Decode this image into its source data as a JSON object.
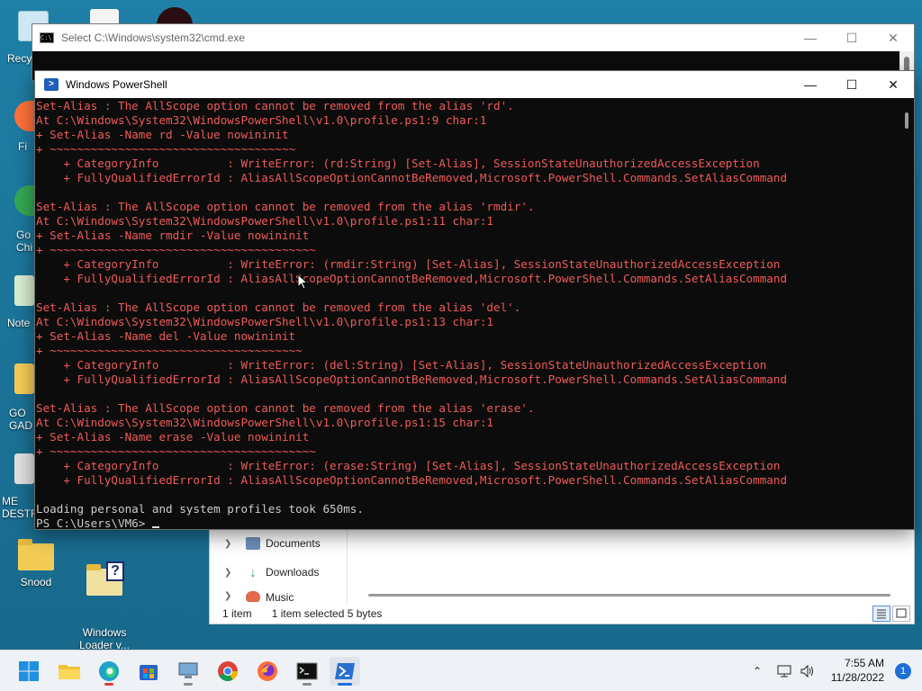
{
  "desktop": {
    "icons": [
      {
        "label": "Snood",
        "icon": "folder-icon"
      },
      {
        "label": "Windows\nLoader v...",
        "icon": "folder-help-icon"
      }
    ],
    "partial_labels": [
      "Recy",
      "Fi",
      "Go\nChi",
      "Note",
      "GO\nGAD",
      "ME\nDESTRU"
    ]
  },
  "cmd_window": {
    "title": "Select C:\\Windows\\system32\\cmd.exe"
  },
  "ps_window": {
    "title": "Windows PowerShell",
    "lines": [
      {
        "type": "error",
        "text": "Set-Alias : The AllScope option cannot be removed from the alias 'rd'."
      },
      {
        "type": "error",
        "text": "At C:\\Windows\\System32\\WindowsPowerShell\\v1.0\\profile.ps1:9 char:1"
      },
      {
        "type": "error",
        "text": "+ Set-Alias -Name rd -Value nowininit"
      },
      {
        "type": "error",
        "text": "+ ~~~~~~~~~~~~~~~~~~~~~~~~~~~~~~~~~~~~"
      },
      {
        "type": "error",
        "text": "    + CategoryInfo          : WriteError: (rd:String) [Set-Alias], SessionStateUnauthorizedAccessException"
      },
      {
        "type": "error",
        "text": "    + FullyQualifiedErrorId : AliasAllScopeOptionCannotBeRemoved,Microsoft.PowerShell.Commands.SetAliasCommand"
      },
      {
        "type": "normal",
        "text": ""
      },
      {
        "type": "error",
        "text": "Set-Alias : The AllScope option cannot be removed from the alias 'rmdir'."
      },
      {
        "type": "error",
        "text": "At C:\\Windows\\System32\\WindowsPowerShell\\v1.0\\profile.ps1:11 char:1"
      },
      {
        "type": "error",
        "text": "+ Set-Alias -Name rmdir -Value nowininit"
      },
      {
        "type": "error",
        "text": "+ ~~~~~~~~~~~~~~~~~~~~~~~~~~~~~~~~~~~~~~~"
      },
      {
        "type": "error",
        "text": "    + CategoryInfo          : WriteError: (rmdir:String) [Set-Alias], SessionStateUnauthorizedAccessException"
      },
      {
        "type": "error",
        "text": "    + FullyQualifiedErrorId : AliasAllScopeOptionCannotBeRemoved,Microsoft.PowerShell.Commands.SetAliasCommand"
      },
      {
        "type": "normal",
        "text": ""
      },
      {
        "type": "error",
        "text": "Set-Alias : The AllScope option cannot be removed from the alias 'del'."
      },
      {
        "type": "error",
        "text": "At C:\\Windows\\System32\\WindowsPowerShell\\v1.0\\profile.ps1:13 char:1"
      },
      {
        "type": "error",
        "text": "+ Set-Alias -Name del -Value nowininit"
      },
      {
        "type": "error",
        "text": "+ ~~~~~~~~~~~~~~~~~~~~~~~~~~~~~~~~~~~~~"
      },
      {
        "type": "error",
        "text": "    + CategoryInfo          : WriteError: (del:String) [Set-Alias], SessionStateUnauthorizedAccessException"
      },
      {
        "type": "error",
        "text": "    + FullyQualifiedErrorId : AliasAllScopeOptionCannotBeRemoved,Microsoft.PowerShell.Commands.SetAliasCommand"
      },
      {
        "type": "normal",
        "text": ""
      },
      {
        "type": "error",
        "text": "Set-Alias : The AllScope option cannot be removed from the alias 'erase'."
      },
      {
        "type": "error",
        "text": "At C:\\Windows\\System32\\WindowsPowerShell\\v1.0\\profile.ps1:15 char:1"
      },
      {
        "type": "error",
        "text": "+ Set-Alias -Name erase -Value nowininit"
      },
      {
        "type": "error",
        "text": "+ ~~~~~~~~~~~~~~~~~~~~~~~~~~~~~~~~~~~~~~~"
      },
      {
        "type": "error",
        "text": "    + CategoryInfo          : WriteError: (erase:String) [Set-Alias], SessionStateUnauthorizedAccessException"
      },
      {
        "type": "error",
        "text": "    + FullyQualifiedErrorId : AliasAllScopeOptionCannotBeRemoved,Microsoft.PowerShell.Commands.SetAliasCommand"
      },
      {
        "type": "normal",
        "text": ""
      },
      {
        "type": "normal",
        "text": "Loading personal and system profiles took 650ms."
      },
      {
        "type": "prompt",
        "text": "PS C:\\Users\\VM6> "
      }
    ]
  },
  "explorer": {
    "nav_items": [
      {
        "label": "Documents",
        "icon": "documents-icon"
      },
      {
        "label": "Downloads",
        "icon": "downloads-icon"
      },
      {
        "label": "Music",
        "icon": "music-icon"
      }
    ],
    "status": {
      "item_count": "1 item",
      "selection": "1 item selected  5 bytes"
    }
  },
  "taskbar": {
    "apps": [
      {
        "name": "start",
        "icon": "windows-start-icon"
      },
      {
        "name": "file-explorer",
        "icon": "folder-icon"
      },
      {
        "name": "edge",
        "icon": "edge-icon"
      },
      {
        "name": "store",
        "icon": "store-icon"
      },
      {
        "name": "remote-desktop",
        "icon": "computer-icon"
      },
      {
        "name": "chrome",
        "icon": "chrome-icon"
      },
      {
        "name": "firefox",
        "icon": "firefox-icon"
      },
      {
        "name": "cmd",
        "icon": "cmd-icon"
      },
      {
        "name": "powershell",
        "icon": "powershell-icon"
      }
    ],
    "clock": {
      "time": "7:55 AM",
      "date": "11/28/2022"
    },
    "notification_count": "1"
  },
  "colors": {
    "desktop_bg": "#1b6e93",
    "console_bg": "#0c0c0c",
    "error_text": "#f05a5a",
    "normal_text": "#cccccc",
    "taskbar_accent": "#1f6fd6"
  }
}
